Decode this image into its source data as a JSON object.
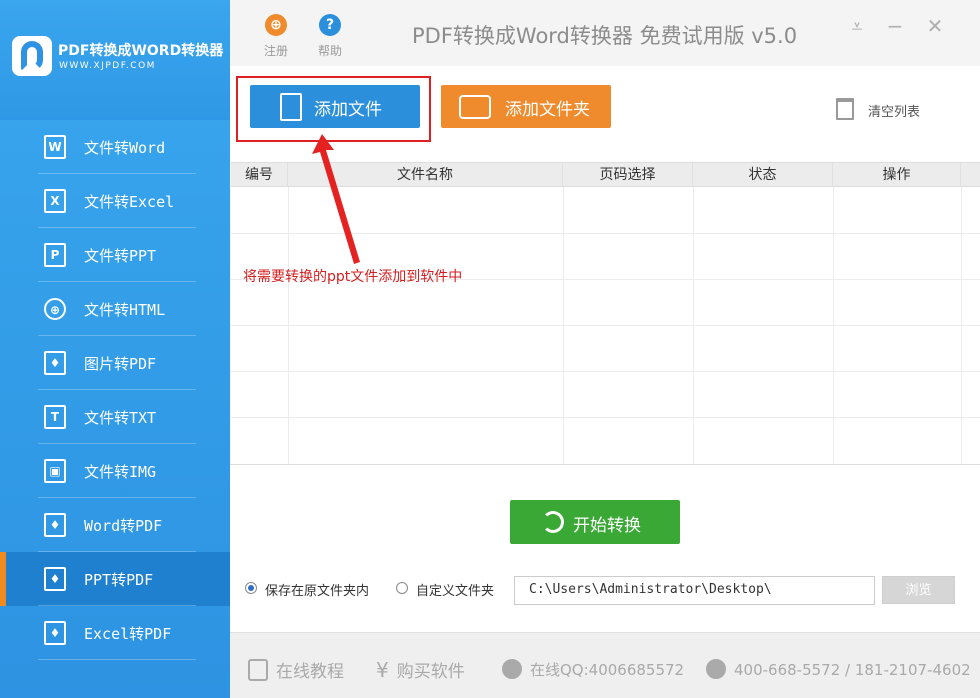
{
  "app": {
    "title": "PDF转换成Word转换器 免费试用版 v5.0",
    "logo_title": "PDF转换成WORD转换器",
    "logo_sub": "WWW.XJPDF.COM"
  },
  "topbar": {
    "register_label": "注册",
    "help_label": "帮助",
    "register_icon_glyph": "⊕",
    "help_icon_glyph": "?"
  },
  "sidebar": {
    "items": [
      {
        "label": "文件转Word",
        "icon": "W"
      },
      {
        "label": "文件转Excel",
        "icon": "X"
      },
      {
        "label": "文件转PPT",
        "icon": "P"
      },
      {
        "label": "文件转HTML",
        "icon": "⊕"
      },
      {
        "label": "图片转PDF",
        "icon": "♦"
      },
      {
        "label": "文件转TXT",
        "icon": "T"
      },
      {
        "label": "文件转IMG",
        "icon": "▣"
      },
      {
        "label": "Word转PDF",
        "icon": "♦"
      },
      {
        "label": "PPT转PDF",
        "icon": "♦"
      },
      {
        "label": "Excel转PDF",
        "icon": "♦"
      }
    ],
    "active_index": 8
  },
  "toolbar": {
    "add_file_label": "添加文件",
    "add_folder_label": "添加文件夹",
    "clear_list_label": "清空列表"
  },
  "table": {
    "headers": [
      "编号",
      "文件名称",
      "页码选择",
      "状态",
      "操作"
    ],
    "rows": []
  },
  "annotation": {
    "text": "将需要转换的ppt文件添加到软件中"
  },
  "actions": {
    "start_label": "开始转换",
    "save_original_label": "保存在原文件夹内",
    "custom_folder_label": "自定义文件夹",
    "output_path": "C:\\Users\\Administrator\\Desktop\\",
    "browse_label": "浏览"
  },
  "footer": {
    "tutorial": "在线教程",
    "buy": "购买软件",
    "qq": "在线QQ:4006685572",
    "phone": "400-668-5572 / 181-2107-4602"
  },
  "colors": {
    "sidebar": "#2d93e2",
    "active_marker": "#f08a1c",
    "add_file": "#2b8fdc",
    "add_folder": "#ef8b2c",
    "start": "#3aa835",
    "annotation": "#d42020"
  }
}
